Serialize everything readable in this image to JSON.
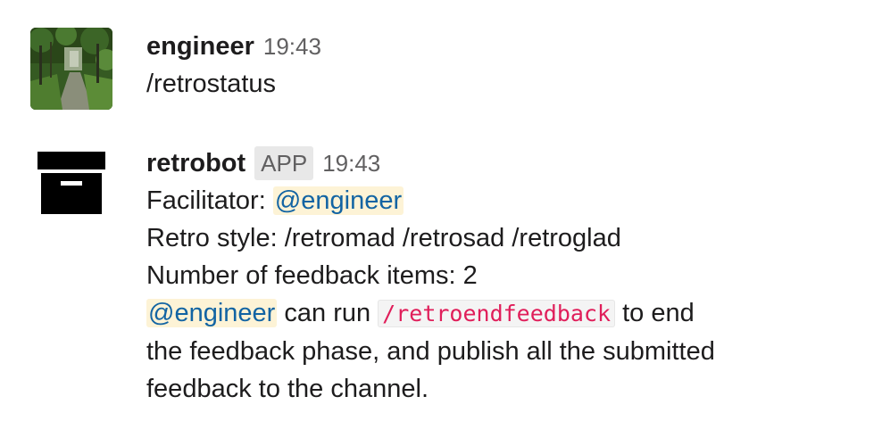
{
  "messages": [
    {
      "user": "engineer",
      "time": "19:43",
      "avatar_icon": "forest-path-photo-avatar",
      "text": "/retrostatus"
    },
    {
      "user": "retrobot",
      "badge": "APP",
      "time": "19:43",
      "avatar_icon": "archive-box-icon",
      "lines": {
        "facilitator_label": "Facilitator:",
        "facilitator_mention": "@engineer",
        "style": "Retro style: /retromad /retrosad /retroglad",
        "count": "Number of feedback items: 2",
        "instruction_mention": "@engineer",
        "instruction_pre": "can run",
        "instruction_command": "/retroendfeedback",
        "instruction_post": "to end",
        "instruction_line2": "the feedback phase, and publish all the submitted",
        "instruction_line3": "feedback to the channel."
      }
    }
  ],
  "colors": {
    "mention_text": "#1264a3",
    "mention_bg": "#fdf3d6",
    "code_text": "#e01e5a",
    "badge_bg": "#e8e8e8"
  }
}
